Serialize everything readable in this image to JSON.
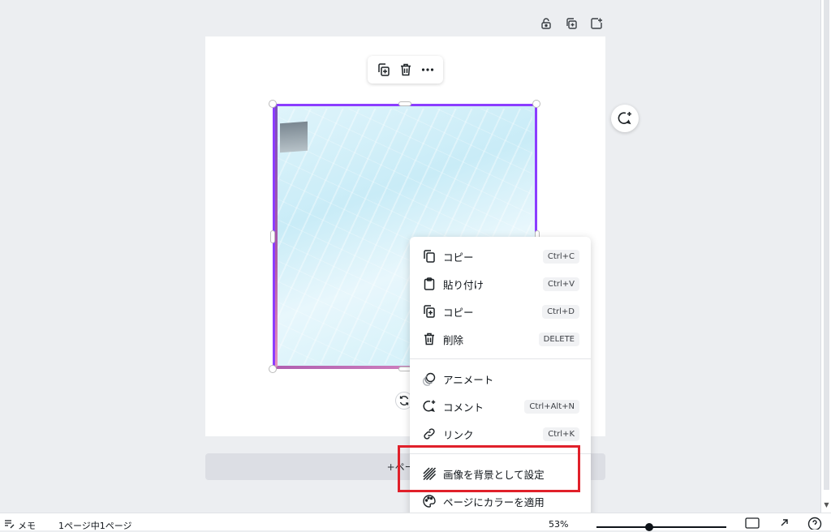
{
  "canvas": {
    "page_actions": [
      {
        "icon": "lock-icon"
      },
      {
        "icon": "duplicate-page-icon"
      },
      {
        "icon": "add-page-icon"
      }
    ],
    "floating_toolbar": [
      {
        "icon": "copy-icon"
      },
      {
        "icon": "trash-icon"
      },
      {
        "icon": "more-icon"
      }
    ],
    "add_page_label": "+ページ"
  },
  "context_menu": {
    "items": [
      {
        "label": "コピー",
        "shortcut": "Ctrl+C",
        "icon": "copy-icon"
      },
      {
        "label": "貼り付け",
        "shortcut": "Ctrl+V",
        "icon": "clipboard-icon"
      },
      {
        "label": "コピー",
        "shortcut": "Ctrl+D",
        "icon": "duplicate-icon"
      },
      {
        "label": "削除",
        "shortcut": "DELETE",
        "icon": "trash-icon"
      },
      {
        "label": "アニメート",
        "shortcut": "",
        "icon": "animate-icon"
      },
      {
        "label": "コメント",
        "shortcut": "Ctrl+Alt+N",
        "icon": "comment-add-icon"
      },
      {
        "label": "リンク",
        "shortcut": "Ctrl+K",
        "icon": "link-icon"
      },
      {
        "label": "画像を背景として設定",
        "shortcut": "",
        "icon": "hatch-background-icon"
      },
      {
        "label": "ページにカラーを適用",
        "shortcut": "",
        "icon": "palette-icon"
      }
    ]
  },
  "status_bar": {
    "notes_label": "メモ",
    "page_info": "1ページ中1ページ",
    "zoom": "53%"
  },
  "colors": {
    "selection": "#8b3dff",
    "highlight": "#e0202a"
  }
}
